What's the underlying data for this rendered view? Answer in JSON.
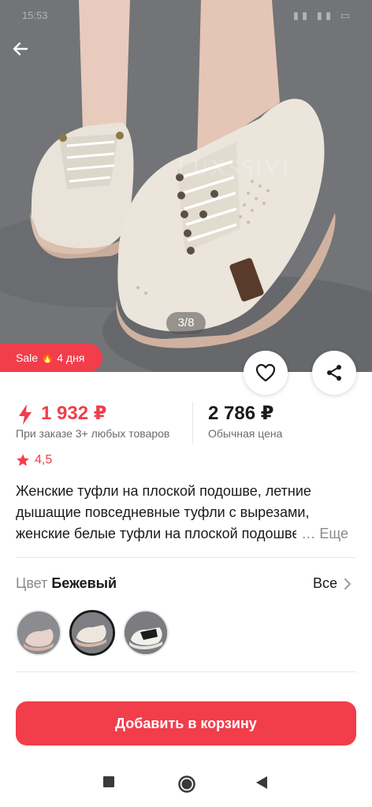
{
  "status_bar": {
    "time": "15:53",
    "icons": "▮▮ ▮▮ ▭"
  },
  "hero": {
    "watermark": "LUXSSIVI",
    "counter": "3/8"
  },
  "sale_badge": {
    "label": "Sale",
    "days": "4 дня"
  },
  "price": {
    "discounted": "1 932 ₽",
    "discounted_note": "При заказе 3+ любых товаров",
    "regular": "2 786 ₽",
    "regular_note": "Обычная цена"
  },
  "rating": {
    "value": "4,5"
  },
  "product": {
    "title": "Женские туфли на плоской подошве, летние дышащие повседневные туфли с вырезами, женские белые туфли на плоской подошве",
    "more": "… Еще"
  },
  "color": {
    "label": "Цвет",
    "value": "Бежевый",
    "all": "Все"
  },
  "actions": {
    "add_to_cart": "Добавить в корзину"
  },
  "colors": {
    "accent": "#f23d4b"
  }
}
